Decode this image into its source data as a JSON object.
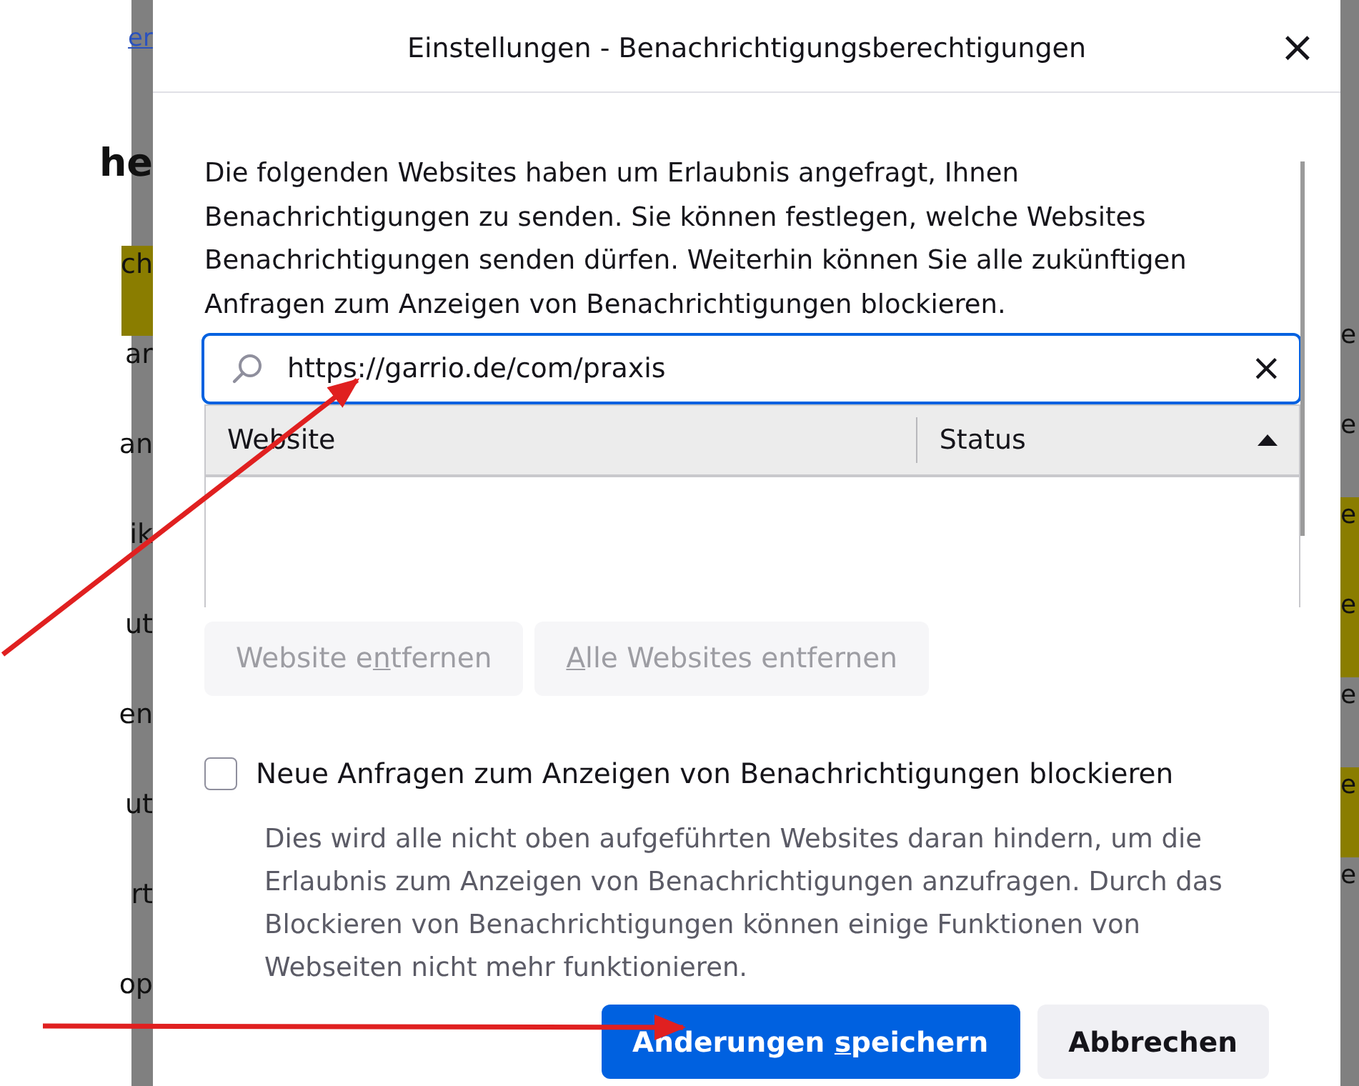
{
  "background_page": {
    "left_fragments": [
      {
        "text": "er",
        "kind": "link"
      },
      {
        "text": "he",
        "kind": "heading"
      },
      {
        "text": "ch",
        "kind": "highlight"
      },
      {
        "text": "ar",
        "kind": "plain"
      },
      {
        "text": "an",
        "kind": "plain"
      },
      {
        "text": "ik",
        "kind": "plain"
      },
      {
        "text": "ut",
        "kind": "plain"
      },
      {
        "text": "en",
        "kind": "plain"
      },
      {
        "text": "ut",
        "kind": "plain"
      },
      {
        "text": "rt",
        "kind": "plain"
      },
      {
        "text": "op",
        "kind": "plain"
      }
    ],
    "right_fragments": [
      {
        "text": "e",
        "kind": "plain"
      },
      {
        "text": "e",
        "kind": "plain"
      },
      {
        "text": "e",
        "kind": "highlight"
      },
      {
        "text": "e",
        "kind": "highlight"
      },
      {
        "text": "e",
        "kind": "plain"
      },
      {
        "text": "e",
        "kind": "highlight"
      },
      {
        "text": "e",
        "kind": "plain"
      }
    ]
  },
  "dialog": {
    "title": "Einstellungen - Benachrichtigungsberechtigungen",
    "close": "×",
    "intro": "Die folgenden Websites haben um Erlaubnis angefragt, Ihnen Benachrichtigungen zu senden. Sie können festlegen, welche Websites Benachrichtigungen senden dürfen. Weiterhin können Sie alle zukünftigen Anfragen zum Anzeigen von Benachrichtigungen blockieren.",
    "search": {
      "value": "https://garrio.de/com/praxis",
      "clear": "×"
    },
    "table": {
      "columns": [
        {
          "label": "Website",
          "sorted": false
        },
        {
          "label": "Status",
          "sorted": true
        }
      ]
    },
    "list_buttons": [
      {
        "before": "Website e",
        "accesskey": "n",
        "after": "tfernen",
        "disabled": true
      },
      {
        "accesskey": "A",
        "after": "lle Websites entfernen",
        "disabled": true
      }
    ],
    "block_checkbox": {
      "label": "Neue Anfragen zum Anzeigen von Benachrichtigungen blockieren",
      "checked": false
    },
    "block_description": "Dies wird alle nicht oben aufgeführten Websites daran hindern, um die Erlaubnis zum Anzeigen von Benachrichtigungen anzufragen. Durch das Blockieren von Benachrichtigungen können einige Funktionen von Webseiten nicht mehr funktionieren.",
    "footer_buttons": [
      {
        "before": "Änderungen ",
        "accesskey": "s",
        "after": "peichern",
        "kind": "primary"
      },
      {
        "before": "Abbrechen",
        "kind": "secondary"
      }
    ]
  }
}
